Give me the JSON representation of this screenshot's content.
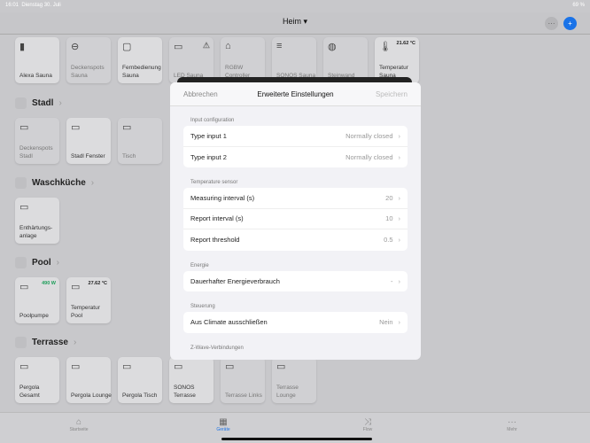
{
  "status": {
    "time": "16:01",
    "date": "Dienstag 30. Juli",
    "battery": "69 %"
  },
  "nav": {
    "title": "Heim ▾",
    "more": "···",
    "add": "+"
  },
  "top_tiles": [
    {
      "label": "Alexa Sauna",
      "icon": "speaker-icon",
      "on": true
    },
    {
      "label": "Deckenspots Sauna",
      "icon": "ceiling-light-icon",
      "on": false
    },
    {
      "label": "Fernbedienung Sauna",
      "icon": "remote-icon",
      "on": true
    },
    {
      "label": "LED Sauna",
      "icon": "led-strip-icon",
      "on": false,
      "warn": "⚠"
    },
    {
      "label": "RGBW Controller",
      "icon": "controller-icon",
      "on": false
    },
    {
      "label": "SONOS Sauna",
      "icon": "sonos-icon",
      "on": false
    },
    {
      "label": "Steinwand",
      "icon": "stone-wall-icon",
      "on": false
    },
    {
      "label": "Temperatur Sauna",
      "icon": "thermometer-icon",
      "on": true,
      "value": "21.62 °C"
    }
  ],
  "sections": [
    {
      "title": "Stadl",
      "tiles": [
        {
          "label": "Deckenspots Stadl",
          "on": false
        },
        {
          "label": "Stadl Fenster",
          "on": true
        },
        {
          "label": "Tisch",
          "on": false
        }
      ]
    },
    {
      "title": "Waschküche",
      "tiles": [
        {
          "label": "Enthärtungs-anlage",
          "on": true
        }
      ]
    },
    {
      "title": "Pool",
      "tiles": [
        {
          "label": "Poolpumpe",
          "on": true,
          "value": "490 W"
        },
        {
          "label": "Temperatur Pool",
          "on": true,
          "value": "27.62 °C"
        }
      ]
    },
    {
      "title": "Terrasse",
      "tiles": [
        {
          "label": "Pergola Gesamt",
          "on": true
        },
        {
          "label": "Pergola Lounge",
          "on": true
        },
        {
          "label": "Pergola Tisch",
          "on": true
        },
        {
          "label": "SONOS Terrasse",
          "on": true
        },
        {
          "label": "Terrasse Links",
          "on": false
        },
        {
          "label": "Terrasse Lounge",
          "on": false
        }
      ]
    }
  ],
  "tabs": [
    {
      "label": "Startseite"
    },
    {
      "label": "Geräte",
      "active": true
    },
    {
      "label": "Flow"
    },
    {
      "label": "Mehr"
    }
  ],
  "modal": {
    "cancel": "Abbrechen",
    "title": "Erweiterte Einstellungen",
    "save": "Speichern",
    "groups": [
      {
        "label": "Input configuration",
        "rows": [
          {
            "k": "Type input 1",
            "v": "Normally closed"
          },
          {
            "k": "Type input 2",
            "v": "Normally closed"
          }
        ]
      },
      {
        "label": "Temperature sensor",
        "rows": [
          {
            "k": "Measuring interval (s)",
            "v": "20"
          },
          {
            "k": "Report interval (s)",
            "v": "10"
          },
          {
            "k": "Report threshold",
            "v": "0.5"
          }
        ]
      },
      {
        "label": "Energie",
        "rows": [
          {
            "k": "Dauerhafter Energieverbrauch",
            "v": "-"
          }
        ]
      },
      {
        "label": "Steuerung",
        "rows": [
          {
            "k": "Aus Climate ausschließen",
            "v": "Nein"
          }
        ]
      },
      {
        "label": "Z-Wave-Verbindungen",
        "rows": []
      }
    ]
  },
  "colors": {
    "accent": "#1a73e8",
    "power": "#1e9e5a",
    "sonos_bars": "#6a2bd8"
  }
}
